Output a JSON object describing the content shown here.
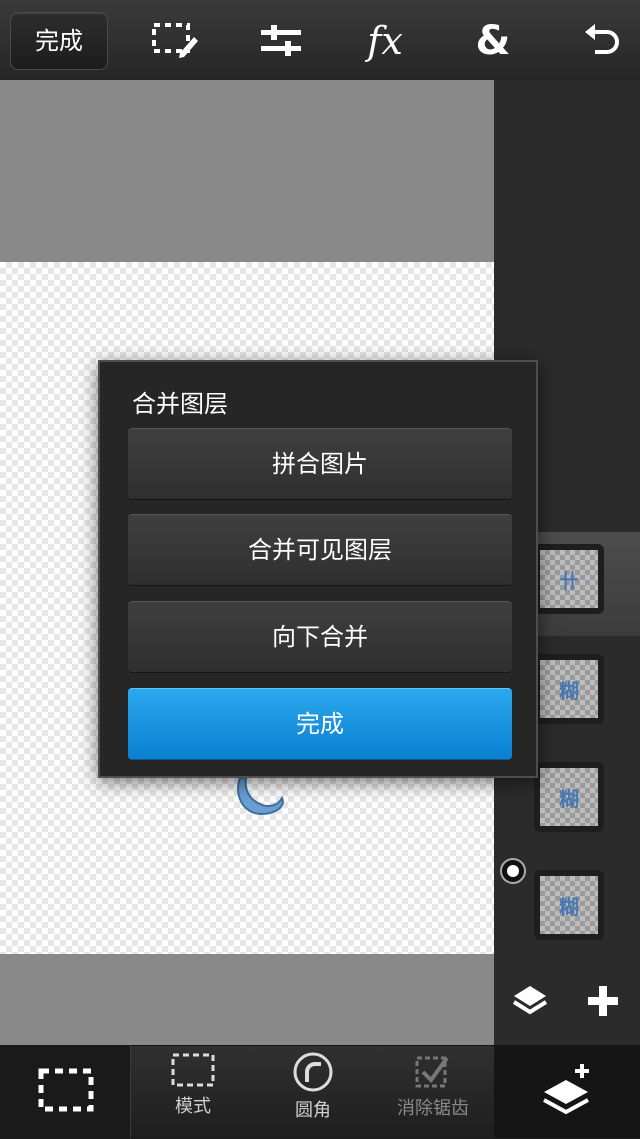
{
  "topbar": {
    "done_label": "完成",
    "icons": [
      "selection-edit-icon",
      "adjustments-icon",
      "fx-icon",
      "ampersand-icon",
      "undo-icon"
    ],
    "fx_text": "fx",
    "amp_text": "&"
  },
  "dialog": {
    "title": "合并图层",
    "flatten_label": "拼合图片",
    "merge_visible_label": "合并可见图层",
    "merge_down_label": "向下合并",
    "done_label": "完成"
  },
  "layers": {
    "thumb_texts": [
      "卄",
      "糊",
      "糊",
      "糊"
    ]
  },
  "bottombar": {
    "mode_label": "模式",
    "round_label": "圆角",
    "antialias_label": "消除锯齿"
  },
  "colors": {
    "primary_button": "#1a93e0",
    "toolbar": "#2a2a2a",
    "canvas_gray": "#898989"
  }
}
